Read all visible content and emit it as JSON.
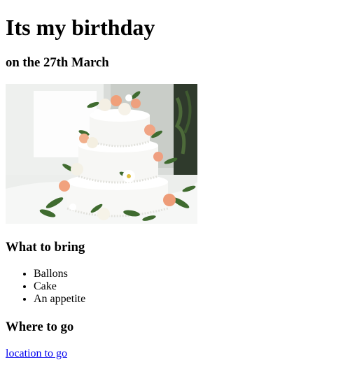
{
  "heading": "Its my birthday",
  "subheading": "on the 27th March",
  "image": {
    "icon": "birthday-cake-photo"
  },
  "bring": {
    "heading": "What to bring",
    "items": [
      "Ballons",
      "Cake",
      "An appetite"
    ]
  },
  "where": {
    "heading": "Where to go",
    "link_text": "location to go"
  },
  "colors": {
    "link": "#0000ee",
    "text": "#000000",
    "background": "#ffffff"
  }
}
